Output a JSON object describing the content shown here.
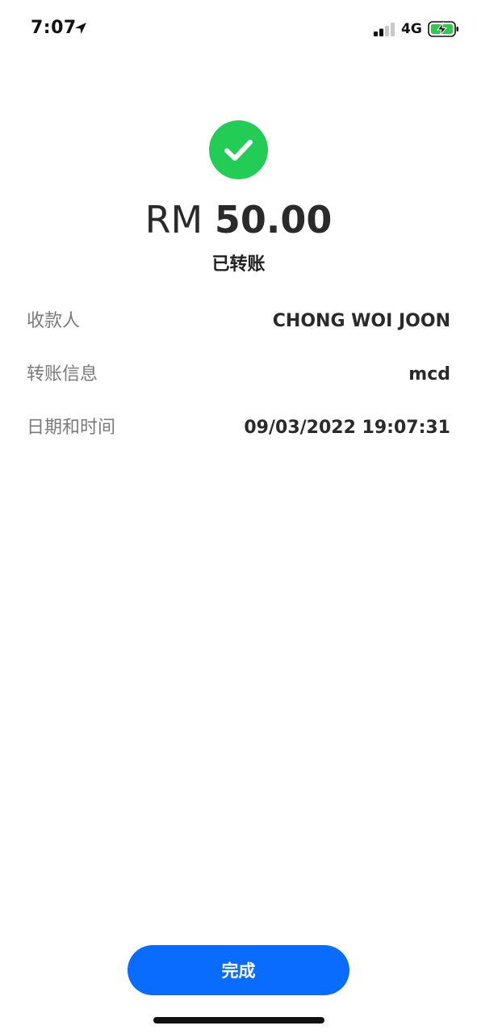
{
  "status_bar": {
    "time": "7:07",
    "network": "4G",
    "icons": {
      "location": "location-arrow-icon",
      "signal": "cellular-signal-icon",
      "battery": "battery-charging-icon"
    },
    "battery_color": "#30c94b"
  },
  "success": {
    "icon": "checkmark-circle-icon",
    "icon_color": "#22cc55",
    "currency": "RM",
    "amount": "50.00",
    "status": "已转账"
  },
  "details": {
    "recipient": {
      "label": "收款人",
      "value": "CHONG WOI JOON"
    },
    "message": {
      "label": "转账信息",
      "value": "mcd"
    },
    "datetime": {
      "label": "日期和时间",
      "value": "09/03/2022 19:07:31"
    }
  },
  "actions": {
    "done_label": "完成",
    "done_color": "#0a6cff"
  }
}
